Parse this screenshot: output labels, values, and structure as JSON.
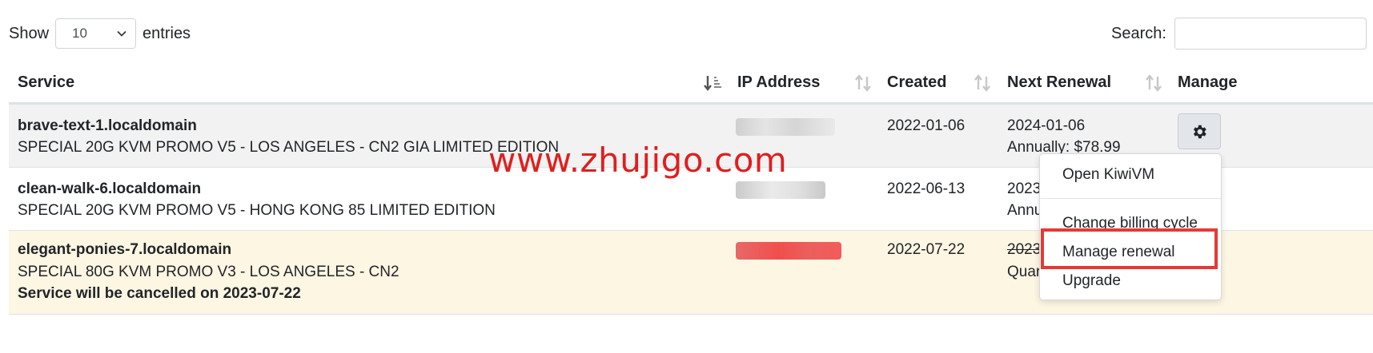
{
  "length": {
    "show_label": "Show",
    "selected": "10",
    "entries_label": "entries"
  },
  "search": {
    "label": "Search:",
    "value": ""
  },
  "table": {
    "headers": [
      "Service",
      "IP Address",
      "Created",
      "Next Renewal",
      "Manage"
    ],
    "rows": [
      {
        "name": "brave-text-1.localdomain",
        "plan": "SPECIAL 20G KVM PROMO V5 - LOS ANGELES - CN2 GIA LIMITED EDITION",
        "created": "2022-01-06",
        "renewal": "2024-01-06",
        "billing": "Annually: $78.99"
      },
      {
        "name": "clean-walk-6.localdomain",
        "plan": "SPECIAL 20G KVM PROMO V5 - HONG KONG 85 LIMITED EDITION",
        "created": "2022-06-13",
        "renewal": "2023",
        "billing": "Annu"
      },
      {
        "name": "elegant-ponies-7.localdomain",
        "plan": "SPECIAL 80G KVM PROMO V3 - LOS ANGELES - CN2",
        "note": "Service will be cancelled on 2023-07-22",
        "created": "2022-07-22",
        "renewal": "2023",
        "billing": "Quar"
      }
    ]
  },
  "manage_menu": {
    "items": [
      "Open KiwiVM",
      "Change billing cycle",
      "Manage renewal",
      "Upgrade"
    ]
  },
  "watermark": "www.zhujigo.com",
  "colors": {
    "highlight": "#e53935",
    "watermark": "#e01e1e",
    "cancelled_row": "#fdf6e3"
  }
}
